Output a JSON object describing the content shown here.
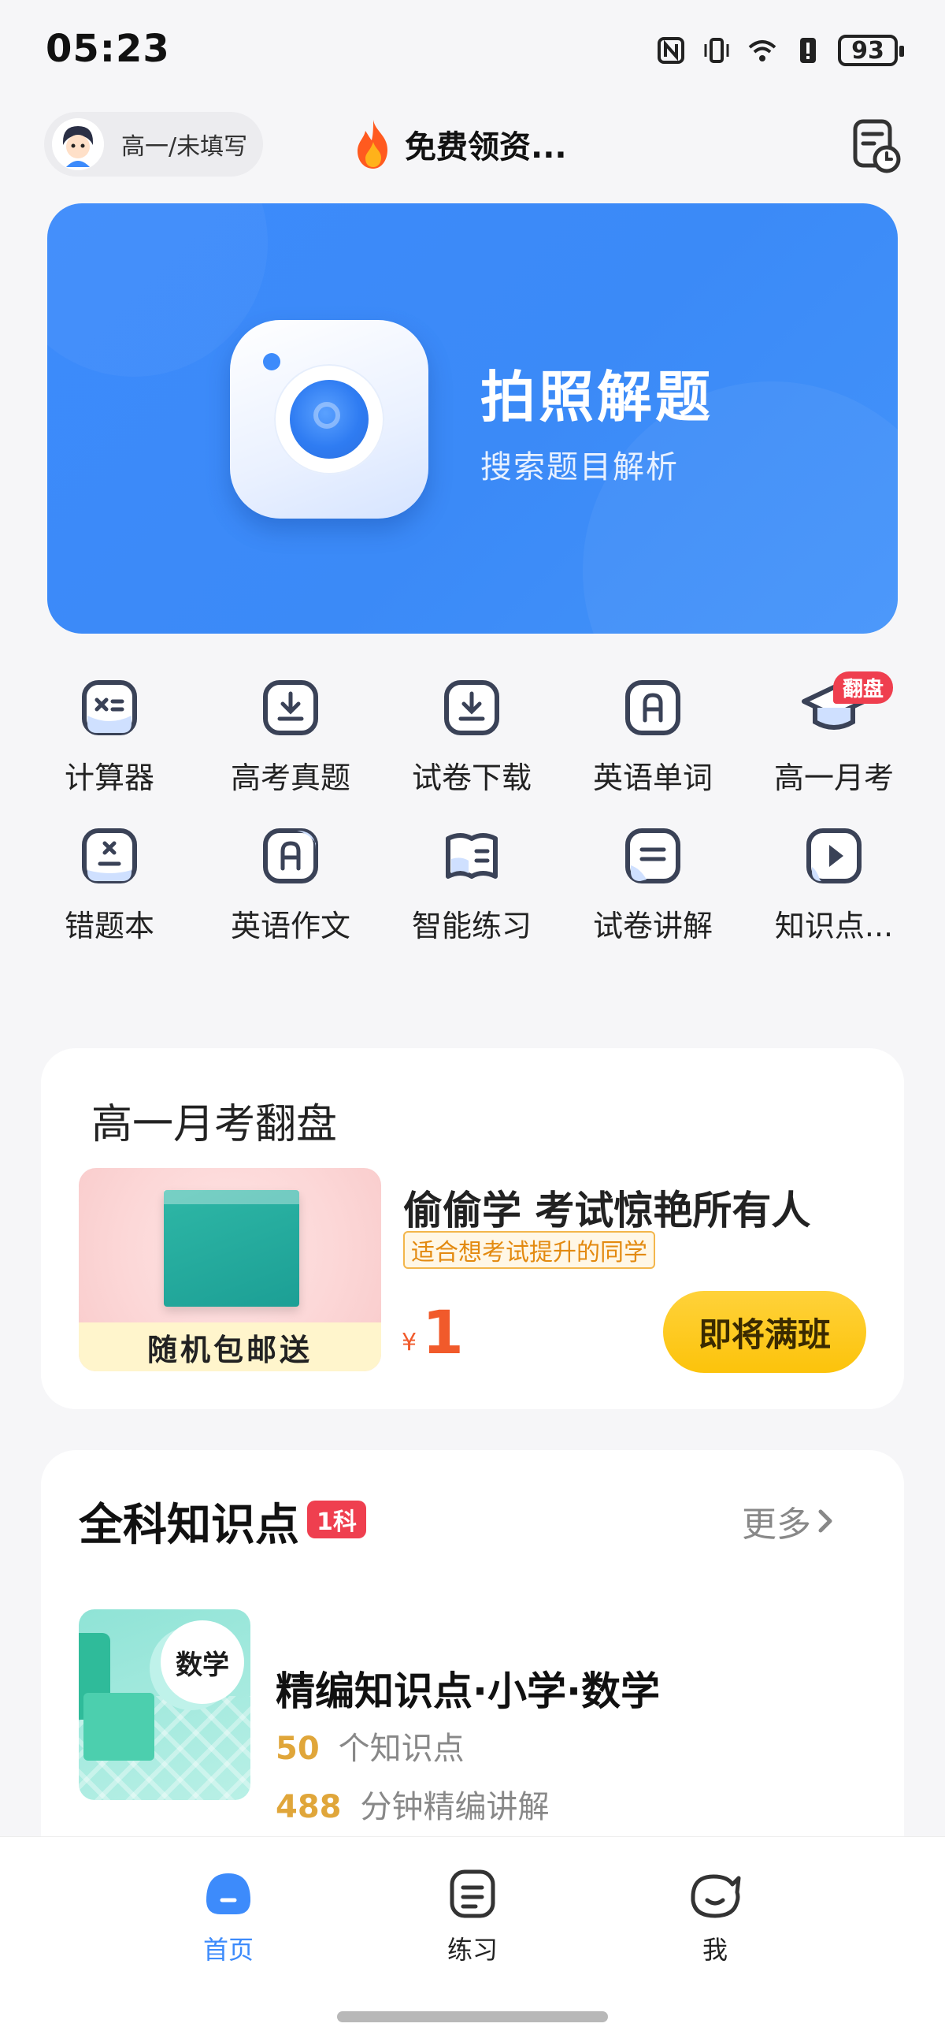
{
  "status_bar": {
    "time": "05:23",
    "battery": "93"
  },
  "header": {
    "grade": "高一/未填写",
    "promo": "免费领资..."
  },
  "banner": {
    "title": "拍照解题",
    "subtitle": "搜索题目解析"
  },
  "tools": [
    {
      "label": "计算器",
      "icon": "calculator-icon"
    },
    {
      "label": "高考真题",
      "icon": "download-icon"
    },
    {
      "label": "试卷下载",
      "icon": "download-icon"
    },
    {
      "label": "英语单词",
      "icon": "letter-a-icon"
    },
    {
      "label": "高一月考",
      "icon": "graduation-cap-icon",
      "badge": "翻盘"
    },
    {
      "label": "错题本",
      "icon": "wrong-book-icon"
    },
    {
      "label": "英语作文",
      "icon": "letter-a-icon"
    },
    {
      "label": "智能练习",
      "icon": "practice-book-icon"
    },
    {
      "label": "试卷讲解",
      "icon": "document-icon"
    },
    {
      "label": "知识点...",
      "icon": "play-icon"
    }
  ],
  "promo_card": {
    "title": "高一月考翻盘",
    "image_caption": "随机包邮送",
    "headline": "偷偷学 考试惊艳所有人",
    "tag": "适合想考试提升的同学",
    "price_symbol": "¥",
    "price": "1",
    "button": "即将满班"
  },
  "knowledge_card": {
    "title": "全科知识点",
    "badge": "1科",
    "more": "更多",
    "course": {
      "cover_label": "数学",
      "title": "精编知识点·小学·数学",
      "points_count": "50",
      "points_label": "个知识点",
      "minutes_count": "488",
      "minutes_label": "分钟精编讲解"
    }
  },
  "bottom_nav": [
    {
      "label": "首页",
      "active": true
    },
    {
      "label": "练习",
      "active": false
    },
    {
      "label": "我",
      "active": false
    }
  ],
  "colors": {
    "primary": "#3d8bfb",
    "accent_red": "#ef3f4f",
    "price_orange": "#f15a2b",
    "button_yellow": "#fcc30b"
  }
}
